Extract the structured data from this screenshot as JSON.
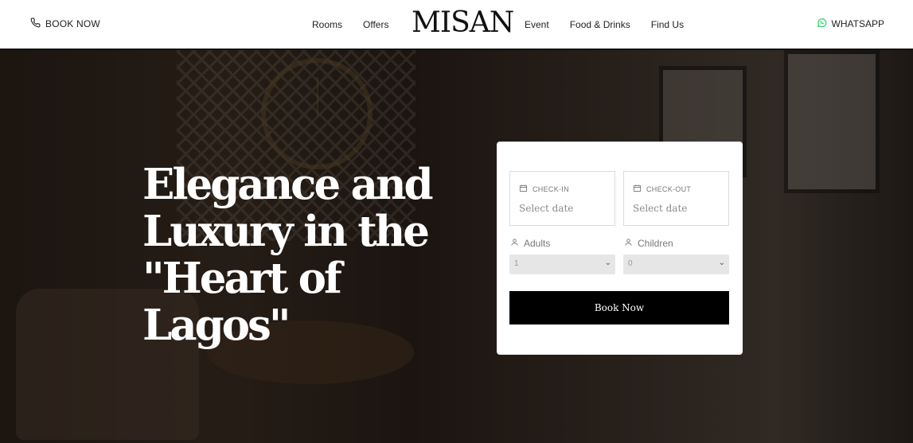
{
  "header": {
    "book_now_label": "BOOK NOW",
    "logo": "MISAN",
    "nav_left": [
      "Rooms",
      "Offers"
    ],
    "nav_right": [
      "Event",
      "Food & Drinks",
      "Find Us"
    ],
    "whatsapp_label": "WHATSAPP",
    "whatsapp_color": "#25D366"
  },
  "hero": {
    "headline_line1": "Elegance and",
    "headline_line2": "Luxury in the",
    "headline_line3": "\"Heart of  Lagos\""
  },
  "booking": {
    "checkin_label": "CHECK-IN",
    "checkin_value": "Select date",
    "checkout_label": "CHECK-OUT",
    "checkout_value": "Select date",
    "adults_label": "Adults",
    "adults_value": "1",
    "children_label": "Children",
    "children_value": "0",
    "button_label": "Book Now"
  }
}
